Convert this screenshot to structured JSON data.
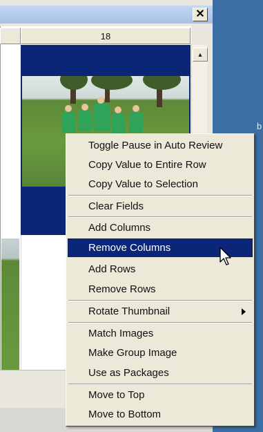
{
  "window": {
    "close_glyph": "✕"
  },
  "grid": {
    "column_header": "18",
    "scroll_up_glyph": "▲"
  },
  "desktop_fragment_text": "b",
  "context_menu": {
    "items": [
      {
        "label": "Toggle Pause in Auto Review"
      },
      {
        "label": "Copy Value to Entire Row"
      },
      {
        "label": "Copy Value to Selection"
      },
      {
        "label": "Clear Fields"
      },
      {
        "label": "Add Columns"
      },
      {
        "label": "Remove Columns",
        "highlighted": true
      },
      {
        "label": "Add Rows"
      },
      {
        "label": "Remove Rows"
      },
      {
        "label": "Rotate Thumbnail",
        "has_submenu": true
      },
      {
        "label": "Match Images"
      },
      {
        "label": "Make Group Image"
      },
      {
        "label": "Use as Packages"
      },
      {
        "label": "Move to Top"
      },
      {
        "label": "Move to Bottom"
      }
    ]
  },
  "colors": {
    "selection": "#0b2577",
    "menu_bg": "#ece9d8",
    "desktop": "#3a6ea5"
  },
  "icons": [
    "close-icon",
    "scroll-up-arrow-icon",
    "submenu-arrow-icon",
    "mouse-pointer-icon"
  ]
}
